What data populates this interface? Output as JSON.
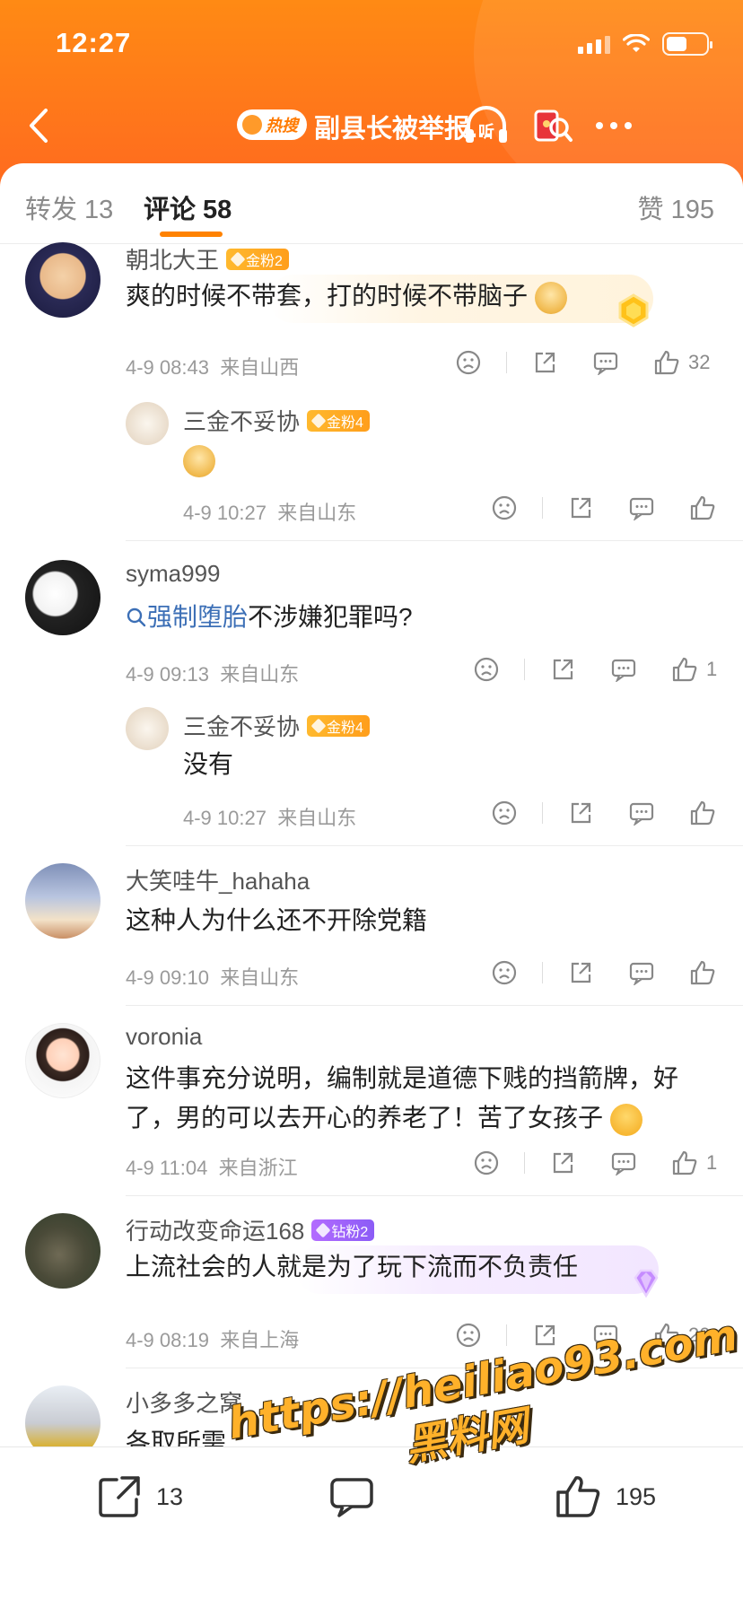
{
  "status_bar": {
    "time": "12:27"
  },
  "nav": {
    "hot_badge": "热搜",
    "title": "副县长被举报...",
    "listen_label": "听"
  },
  "tabs": {
    "repost": "转发 13",
    "comment": "评论 58",
    "like": "赞 195"
  },
  "comments": [
    {
      "user": "朝北大王",
      "badge": "金粉2",
      "badge_type": "gold",
      "text": "爽的时候不带套，打的时候不带脑子",
      "time": "4-9 08:43",
      "location": "来自山西",
      "likes": "32",
      "reply": {
        "user": "三金不妥协",
        "badge": "金粉4",
        "time": "4-9 10:27",
        "location": "来自山东"
      }
    },
    {
      "user": "syma999",
      "topic": "强制堕胎",
      "text": "不涉嫌犯罪吗?",
      "time": "4-9 09:13",
      "location": "来自山东",
      "likes": "1",
      "reply": {
        "user": "三金不妥协",
        "badge": "金粉4",
        "text": "没有",
        "time": "4-9 10:27",
        "location": "来自山东"
      }
    },
    {
      "user": "大笑哇牛_hahaha",
      "text": "这种人为什么还不开除党籍",
      "time": "4-9 09:10",
      "location": "来自山东"
    },
    {
      "user": "voronia",
      "text_line1": "这件事充分说明，编制就是道德下贱的挡箭牌，好",
      "text_line2": "了，男的可以去开心的养老了！苦了女孩子",
      "time": "4-9 11:04",
      "location": "来自浙江",
      "likes": "1"
    },
    {
      "user": "行动改变命运168",
      "badge": "钻粉2",
      "badge_type": "diamond",
      "text": "上流社会的人就是为了玩下流而不负责任",
      "time": "4-9 08:19",
      "location": "来自上海",
      "likes": "20"
    },
    {
      "user": "小多多之窝",
      "text": "各取所需"
    }
  ],
  "bottom_bar": {
    "repost_count": "13",
    "like_count": "195"
  },
  "watermark": {
    "url": "https://heiliao93.com",
    "name": "黑料网"
  },
  "colors": {
    "header": "#ff7a1a",
    "accent": "#ff8200",
    "topic": "#3c6fb6"
  }
}
